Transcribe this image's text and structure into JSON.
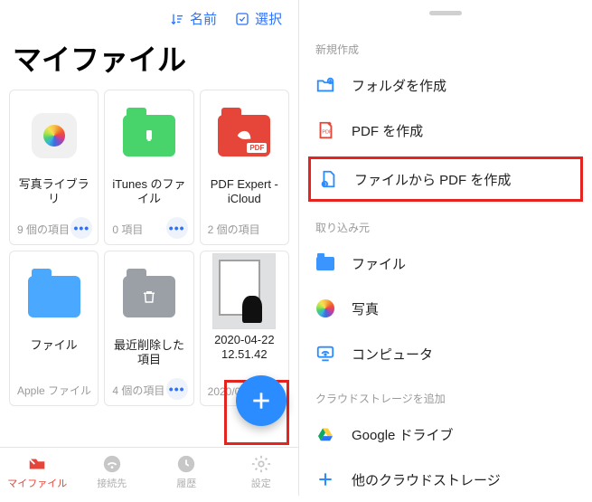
{
  "left": {
    "toolbar": {
      "sort": "名前",
      "select": "選択"
    },
    "title": "マイファイル",
    "files": [
      {
        "name": "写真ライブラリ",
        "meta": "9 個の項目"
      },
      {
        "name": "iTunes のファイル",
        "meta": "0 項目"
      },
      {
        "name": "PDF Expert - iCloud",
        "meta": "2 個の項目"
      },
      {
        "name": "ファイル",
        "meta": "Apple ファイル"
      },
      {
        "name": "最近削除した項目",
        "meta": "4 個の項目"
      },
      {
        "name": "2020-04-22 12.51.42",
        "meta": "2020/0"
      }
    ],
    "tabs": [
      "マイファイル",
      "接続先",
      "履歴",
      "設定"
    ]
  },
  "right": {
    "sect_create": "新規作成",
    "create": [
      "フォルダを作成",
      "PDF を作成",
      "ファイルから PDF を作成"
    ],
    "sect_import": "取り込み元",
    "import": [
      "ファイル",
      "写真",
      "コンピュータ"
    ],
    "sect_cloud": "クラウドストレージを追加",
    "cloud": [
      "Google ドライブ",
      "他のクラウドストレージ"
    ]
  }
}
